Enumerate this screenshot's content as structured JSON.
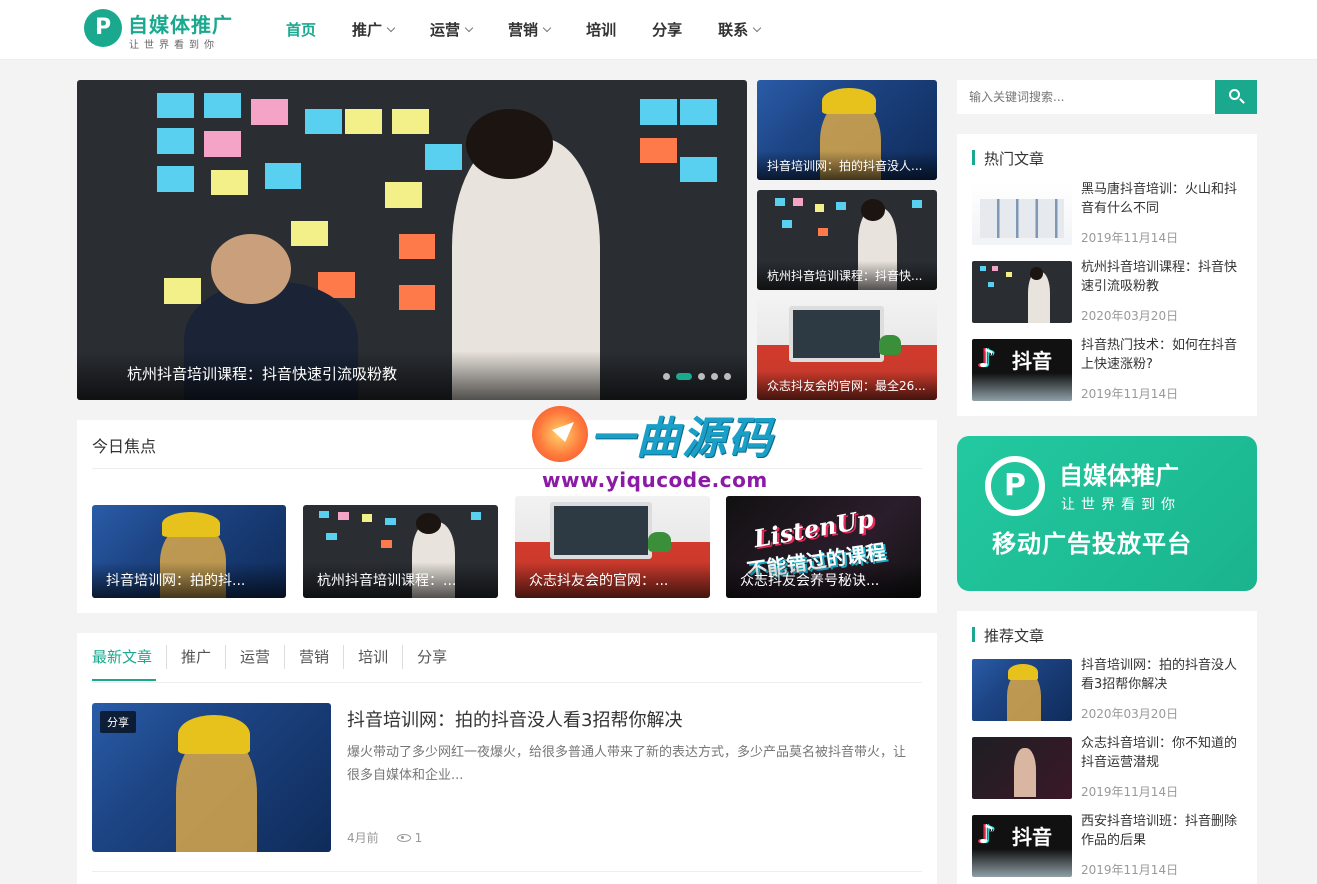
{
  "brand": {
    "logo_mark": "P",
    "title": "自媒体推广",
    "tagline": "让世界看到你"
  },
  "nav": {
    "items": [
      {
        "label": "首页",
        "active": true,
        "dropdown": false
      },
      {
        "label": "推广",
        "active": false,
        "dropdown": true
      },
      {
        "label": "运营",
        "active": false,
        "dropdown": true
      },
      {
        "label": "营销",
        "active": false,
        "dropdown": true
      },
      {
        "label": "培训",
        "active": false,
        "dropdown": false
      },
      {
        "label": "分享",
        "active": false,
        "dropdown": false
      },
      {
        "label": "联系",
        "active": false,
        "dropdown": true
      }
    ]
  },
  "slider": {
    "main_caption": "杭州抖音培训课程：抖音快速引流吸粉教",
    "active_dot": 2,
    "dot_count": 5,
    "side": [
      {
        "caption": "抖音培训网：拍的抖音没人..."
      },
      {
        "caption": "杭州抖音培训课程：抖音快..."
      },
      {
        "caption": "众志抖友会的官网：最全26..."
      }
    ]
  },
  "focus": {
    "title": "今日焦点",
    "items": [
      {
        "caption": "抖音培训网：拍的抖..."
      },
      {
        "caption": "杭州抖音培训课程：..."
      },
      {
        "caption": "众志抖友会的官网：..."
      },
      {
        "caption": "众志抖友会养号秘诀..."
      }
    ]
  },
  "latest": {
    "tabs": [
      "最新文章",
      "推广",
      "运营",
      "营销",
      "培训",
      "分享"
    ],
    "post": {
      "badge": "分享",
      "title": "抖音培训网：拍的抖音没人看3招帮你解决",
      "excerpt": "爆火带动了多少网红一夜爆火，给很多普通人带来了新的表达方式，多少产品莫名被抖音带火，让很多自媒体和企业...",
      "time": "4月前",
      "views": "1"
    }
  },
  "search": {
    "placeholder": "输入关键词搜索..."
  },
  "hot": {
    "title": "热门文章",
    "items": [
      {
        "title": "黑马唐抖音培训：火山和抖音有什么不同",
        "date": "2019年11月14日"
      },
      {
        "title": "杭州抖音培训课程：抖音快速引流吸粉教",
        "date": "2020年03月20日"
      },
      {
        "title": "抖音热门技术：如何在抖音上快速涨粉?",
        "date": "2019年11月14日"
      }
    ]
  },
  "ad": {
    "mark": "P",
    "title": "自媒体推广",
    "sub": "让世界看到你",
    "line": "移动广告投放平台"
  },
  "recommend": {
    "title": "推荐文章",
    "items": [
      {
        "title": "抖音培训网：拍的抖音没人看3招帮你解决",
        "date": "2020年03月20日"
      },
      {
        "title": "众志抖音培训：你不知道的抖音运营潜规",
        "date": "2019年11月14日"
      },
      {
        "title": "西安抖音培训班：抖音删除作品的后果",
        "date": "2019年11月14日"
      }
    ]
  },
  "tiktok_thumb": {
    "note": "♪",
    "text": "抖音"
  },
  "listen_thumb": {
    "line1": "ListenUp",
    "line2": "不能错过的课程"
  },
  "watermark": {
    "cn": "一曲源码",
    "url": "www.yiqucode.com"
  },
  "colors": {
    "accent": "#1aa98f",
    "text": "#333333",
    "muted": "#999999"
  }
}
